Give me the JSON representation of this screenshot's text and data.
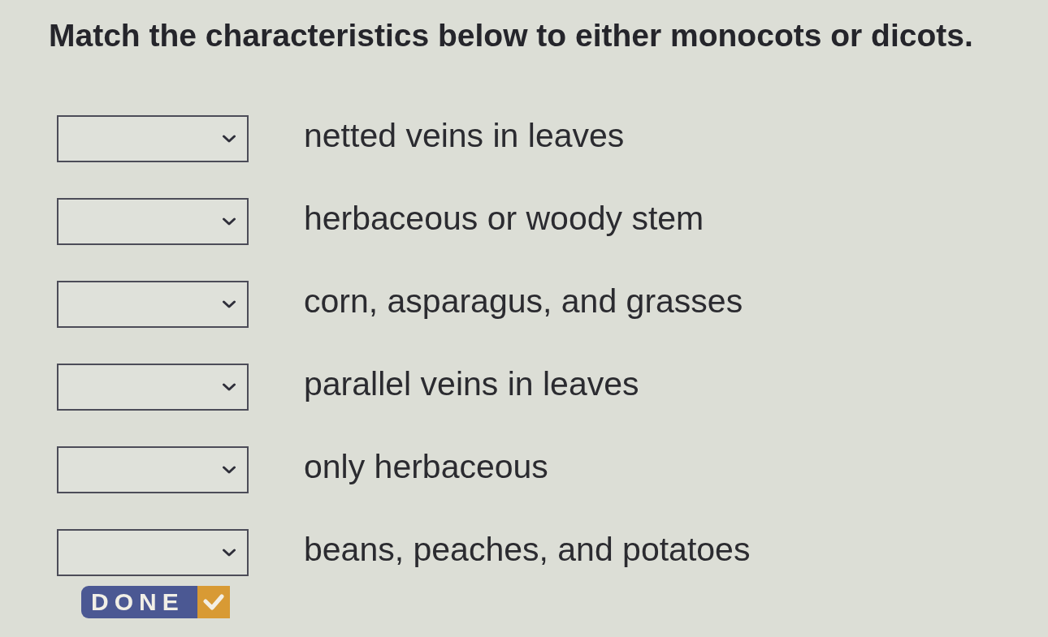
{
  "instruction": "Match the characteristics below to either monocots or dicots.",
  "items": [
    {
      "label": "netted veins in leaves"
    },
    {
      "label": "herbaceous or woody stem"
    },
    {
      "label": "corn, asparagus, and grasses"
    },
    {
      "label": "parallel veins in leaves"
    },
    {
      "label": "only herbaceous"
    },
    {
      "label": "beans, peaches, and potatoes"
    }
  ],
  "done_button": {
    "label": "DONE"
  }
}
